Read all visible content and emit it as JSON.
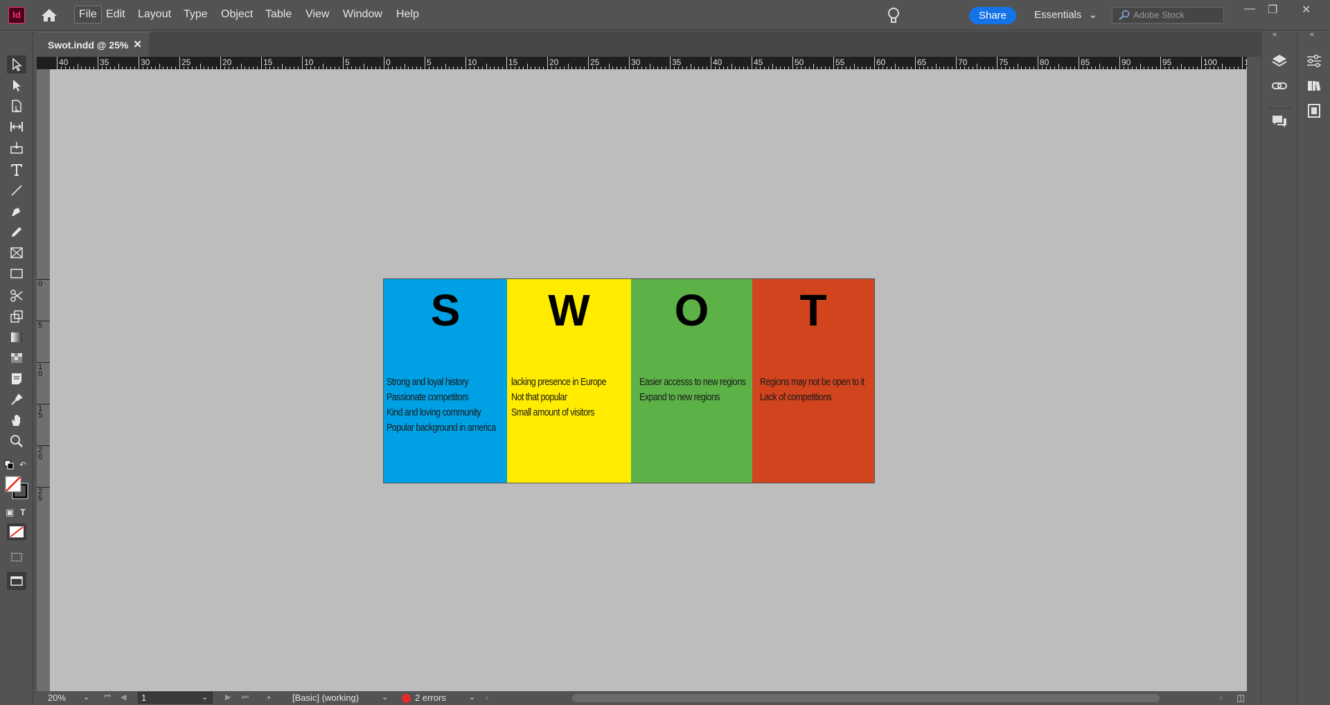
{
  "app": {
    "logo_text": "Id"
  },
  "menu": {
    "items": [
      "File",
      "Edit",
      "Layout",
      "Type",
      "Object",
      "Table",
      "View",
      "Window",
      "Help"
    ]
  },
  "header": {
    "share_label": "Share",
    "workspace_label": "Essentials",
    "stock_placeholder": "Adobe Stock"
  },
  "tab": {
    "title": "Swot.indd @ 25%",
    "close": "✕"
  },
  "ruler": {
    "h_labels": [
      "40",
      "35",
      "30",
      "25",
      "20",
      "15",
      "10",
      "5",
      "0",
      "5",
      "10",
      "15",
      "20",
      "25",
      "30",
      "35",
      "40",
      "45",
      "50",
      "55",
      "60",
      "65",
      "70",
      "75",
      "80",
      "85",
      "90",
      "95",
      "100",
      "1"
    ],
    "v_labels": [
      "0",
      "5",
      "10",
      "15",
      "20",
      "25"
    ]
  },
  "swot": {
    "columns": [
      {
        "letter": "S",
        "color": "#00a0e4",
        "lines": [
          "Strong and loyal history",
          "Passionate competitors",
          "Kind and loving community",
          "Popular background in america"
        ]
      },
      {
        "letter": "W",
        "color": "#ffec00",
        "lines": [
          "lacking presence in Europe",
          "Not that popular",
          "Small amount of visitors"
        ]
      },
      {
        "letter": "O",
        "color": "#5cb247",
        "lines": [
          "Easier accesss to new regions",
          "Expand to new regions"
        ]
      },
      {
        "letter": "T",
        "color": "#d2441e",
        "lines": [
          "Regions may not be open to it",
          "Lack of competitions"
        ]
      }
    ]
  },
  "status": {
    "zoom": "20%",
    "page": "1",
    "style": "[Basic] (working)",
    "errors": "2 errors"
  }
}
